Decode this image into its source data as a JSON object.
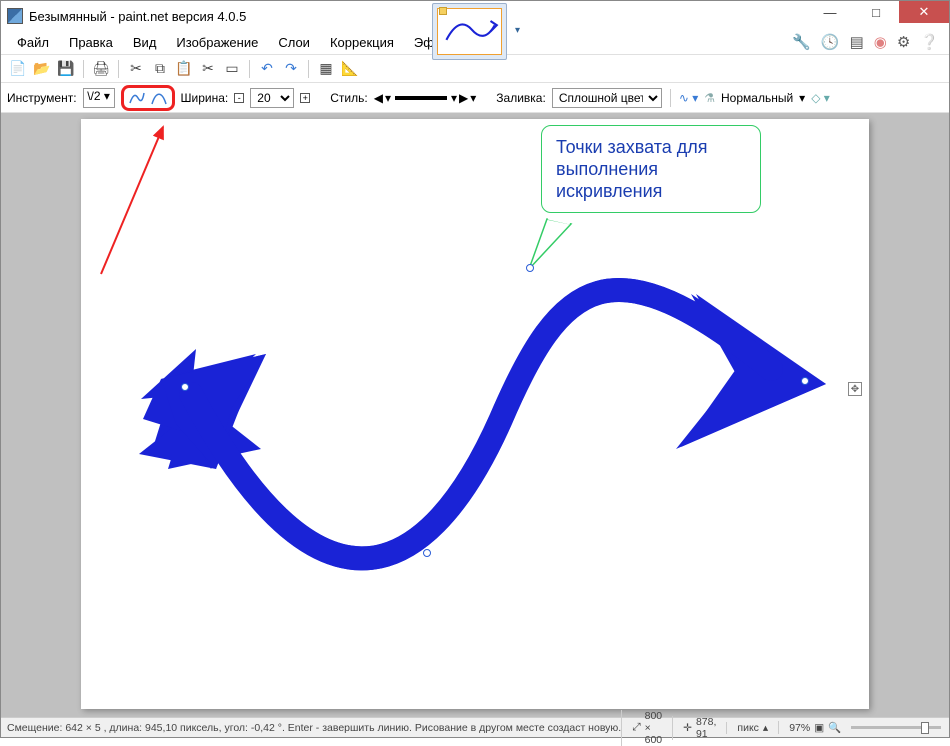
{
  "title": "Безымянный - paint.net версия 4.0.5",
  "menu": [
    "Файл",
    "Правка",
    "Вид",
    "Изображение",
    "Слои",
    "Коррекция",
    "Эффекты"
  ],
  "toolbar_opts": {
    "instrument_label": "Инструмент:",
    "instrument_value": "\\/2",
    "width_label": "Ширина:",
    "width_value": "20",
    "style_label": "Стиль:",
    "fill_label": "Заливка:",
    "fill_value": "Сплошной цвет",
    "blend_label": "Нормальный"
  },
  "callout_text": "Точки захвата для выполнения искривления",
  "status": {
    "left": "Смещение: 642 × 5 , длина: 945,10 пиксель, угол: -0,42 °. Enter - завершить линию. Рисование в другом месте создаст новую.",
    "dims": "800 × 600",
    "cursor": "878, 91",
    "units": "пикс",
    "zoom": "97%"
  },
  "colors": {
    "accent_blue": "#1a23d6",
    "highlight_red": "#e22",
    "callout_green": "#33cc66"
  }
}
